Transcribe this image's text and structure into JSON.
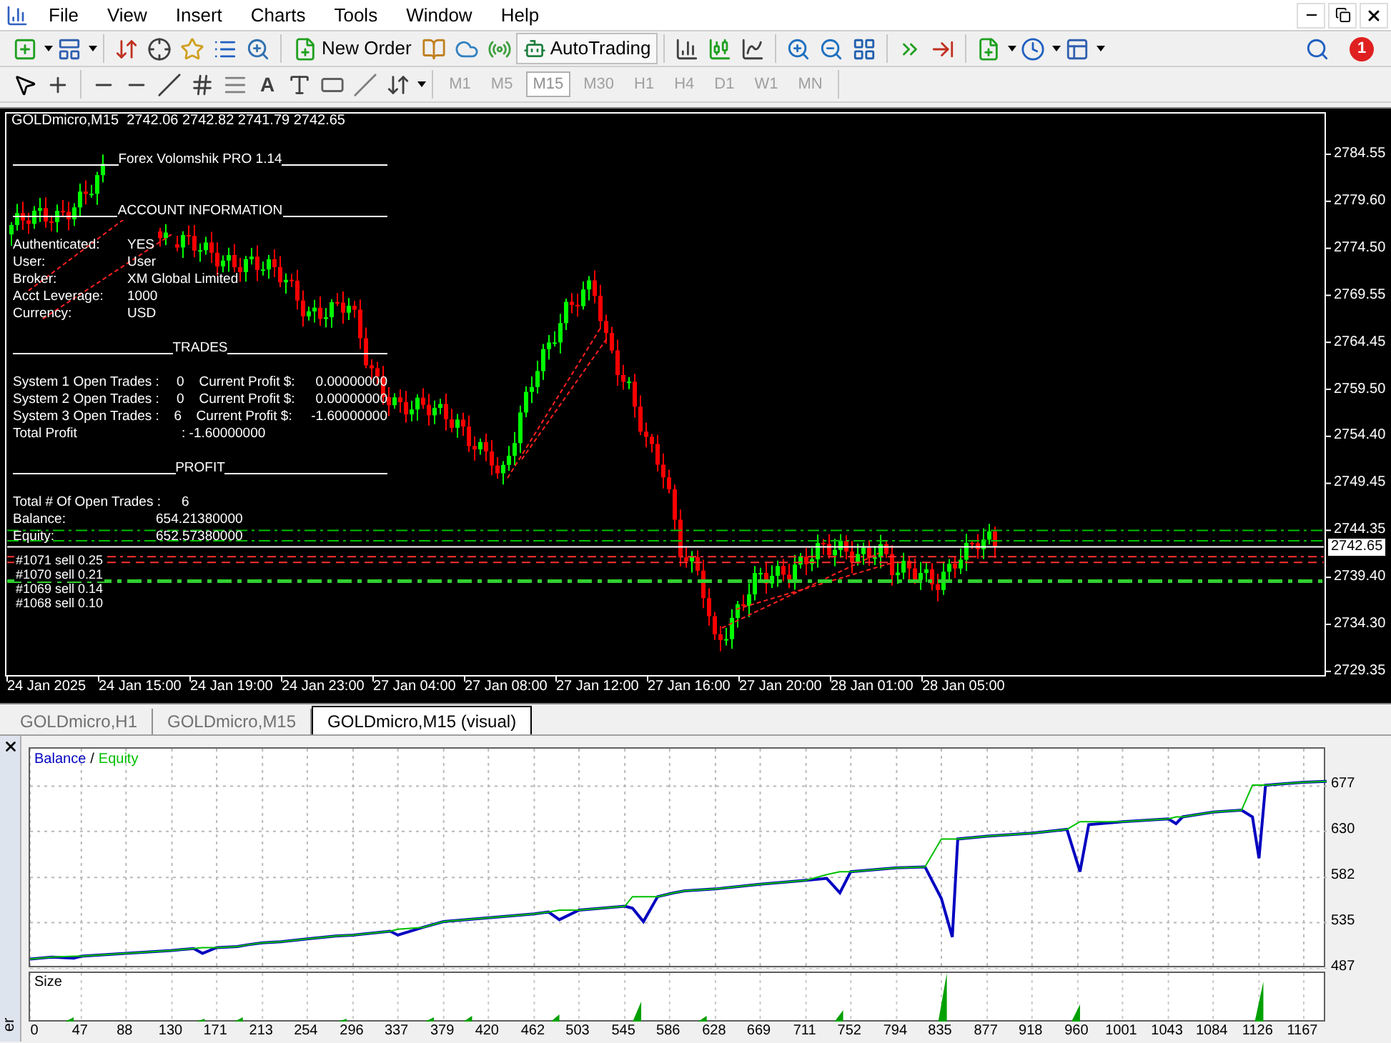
{
  "menu": [
    "File",
    "View",
    "Insert",
    "Charts",
    "Tools",
    "Window",
    "Help"
  ],
  "toolbar": {
    "new_order": "New Order",
    "autotrading": "AutoTrading",
    "notification_count": "1",
    "text_tool": "A"
  },
  "timeframes": [
    {
      "label": "M1",
      "selected": false
    },
    {
      "label": "M5",
      "selected": false
    },
    {
      "label": "M15",
      "selected": true
    },
    {
      "label": "M30",
      "selected": false
    },
    {
      "label": "H1",
      "selected": false
    },
    {
      "label": "H4",
      "selected": false
    },
    {
      "label": "D1",
      "selected": false
    },
    {
      "label": "W1",
      "selected": false
    },
    {
      "label": "MN",
      "selected": false
    }
  ],
  "chart": {
    "symbol_line": "GOLDmicro,M15  2742.06 2742.82 2741.79 2742.65",
    "info_lines": [
      {
        "kind": "header",
        "text": "Forex Volomshik PRO 1.14"
      },
      {
        "kind": "header",
        "text": "ACCOUNT INFORMATION"
      },
      {
        "kind": "pair",
        "label": "Authenticated:",
        "value": "YES"
      },
      {
        "kind": "pair",
        "label": "User:",
        "value": "User"
      },
      {
        "kind": "pair",
        "label": "Broker:",
        "value": "XM Global Limited"
      },
      {
        "kind": "pair",
        "label": "Acct Leverage:",
        "value": "1000"
      },
      {
        "kind": "pair",
        "label": "Currency:",
        "value": "USD"
      },
      {
        "kind": "header",
        "text": "TRADES"
      },
      {
        "kind": "system",
        "label": "System 1 Open Trades :",
        "count": "0",
        "profit_label": "Current Profit $:",
        "profit": "0.00000000"
      },
      {
        "kind": "system",
        "label": "System 2 Open Trades :",
        "count": "0",
        "profit_label": "Current Profit $:",
        "profit": "0.00000000"
      },
      {
        "kind": "system",
        "label": "System 3 Open Trades :",
        "count": "6",
        "profit_label": "Current Profit $:",
        "profit": "-1.60000000"
      },
      {
        "kind": "total",
        "label": "Total Profit",
        "value": ":  -1.60000000"
      },
      {
        "kind": "header",
        "text": "PROFIT"
      },
      {
        "kind": "total",
        "label": "Total # Of Open Trades :",
        "value": "6"
      },
      {
        "kind": "money",
        "label": "Balance:",
        "value": "654.21380000"
      },
      {
        "kind": "money",
        "label": "Equity:",
        "value": "652.57380000"
      }
    ],
    "order_labels": [
      "#1071 sell 0.25",
      "#1070 sell 0.21",
      "#1069 sell 0.14",
      "#1068 sell 0.10"
    ],
    "price_ticks": [
      "2784.55",
      "2779.60",
      "2774.50",
      "2769.55",
      "2764.45",
      "2759.50",
      "2754.40",
      "2749.45",
      "2744.35",
      "2739.40",
      "2734.30",
      "2729.35"
    ],
    "current_price": "2742.65",
    "time_labels": [
      "24 Jan 2025",
      "24 Jan 15:00",
      "24 Jan 19:00",
      "24 Jan 23:00",
      "27 Jan 04:00",
      "27 Jan 08:00",
      "27 Jan 12:00",
      "27 Jan 16:00",
      "27 Jan 20:00",
      "28 Jan 01:00",
      "28 Jan 05:00"
    ]
  },
  "tabs": [
    {
      "label": "GOLDmicro,H1",
      "selected": false
    },
    {
      "label": "GOLDmicro,M15",
      "selected": false
    },
    {
      "label": "GOLDmicro,M15 (visual)",
      "selected": true
    }
  ],
  "tester": {
    "sidebar_label": "er",
    "legend_separator": "/",
    "size_label": "Size",
    "chart_data": {
      "type": "line",
      "x": [
        0,
        20,
        40,
        47,
        88,
        130,
        150,
        158,
        171,
        190,
        200,
        213,
        230,
        254,
        280,
        296,
        330,
        337,
        360,
        379,
        420,
        462,
        475,
        485,
        503,
        545,
        552,
        562,
        575,
        590,
        600,
        628,
        669,
        711,
        730,
        742,
        752,
        794,
        820,
        835,
        845,
        850,
        877,
        918,
        950,
        962,
        970,
        1001,
        1043,
        1050,
        1056,
        1084,
        1110,
        1120,
        1126,
        1132,
        1167,
        1188
      ],
      "series": [
        {
          "name": "Balance",
          "color": "#0000c0",
          "values": [
            497,
            499,
            498,
            500,
            503,
            506,
            508,
            503,
            509,
            510,
            512,
            514,
            515,
            518,
            521,
            522,
            526,
            522,
            530,
            536,
            540,
            544,
            546,
            538,
            548,
            552,
            550,
            536,
            562,
            566,
            568,
            570,
            575,
            579,
            581,
            566,
            588,
            592,
            593,
            560,
            520,
            622,
            625,
            628,
            632,
            588,
            637,
            640,
            643,
            638,
            645,
            650,
            652,
            645,
            602,
            678,
            681,
            682
          ]
        },
        {
          "name": "Equity",
          "color": "#00c000",
          "values": [
            497,
            499,
            500,
            500,
            503,
            506,
            508,
            509,
            509,
            510,
            512,
            514,
            515,
            518,
            521,
            522,
            526,
            528,
            530,
            536,
            540,
            544,
            546,
            548,
            548,
            552,
            562,
            562,
            562,
            566,
            568,
            570,
            575,
            579,
            585,
            588,
            588,
            592,
            593,
            622,
            622,
            622,
            625,
            628,
            632,
            640,
            640,
            640,
            643,
            645,
            645,
            650,
            652,
            678,
            678,
            678,
            681,
            682
          ]
        }
      ],
      "xlim": [
        0,
        1188
      ],
      "ylim": [
        487,
        716
      ],
      "xticks": [
        0,
        47,
        88,
        130,
        171,
        213,
        254,
        296,
        337,
        379,
        420,
        462,
        503,
        545,
        586,
        628,
        669,
        711,
        752,
        794,
        835,
        877,
        918,
        960,
        1001,
        1043,
        1084,
        1126,
        1167
      ],
      "yticks": [
        487,
        535,
        582,
        630,
        677
      ],
      "grid": true
    }
  }
}
